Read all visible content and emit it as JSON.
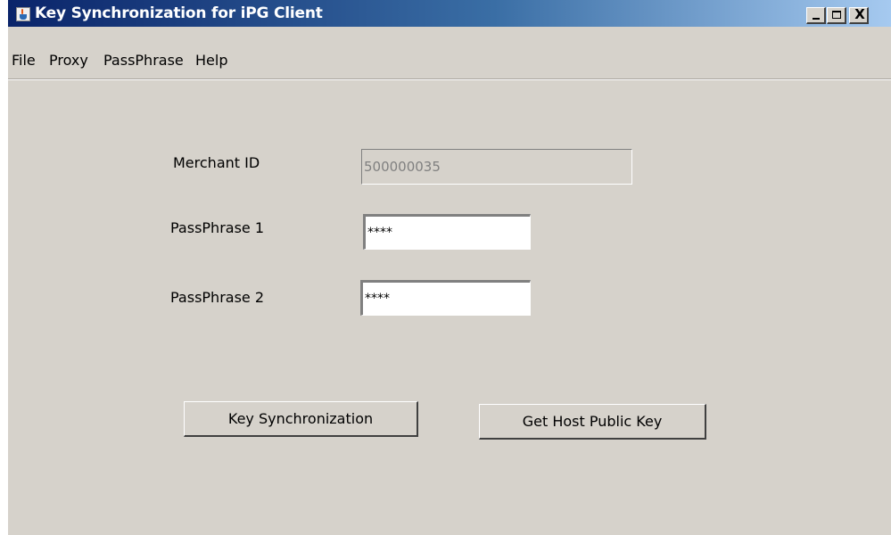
{
  "window": {
    "title": "Key Synchronization for iPG Client",
    "icon": "java-cup-icon",
    "controls": {
      "minimize_icon": "minimize-icon",
      "maximize_icon": "maximize-icon",
      "close_label": "X"
    },
    "colors": {
      "titlebar_start": "#0a246a",
      "titlebar_end": "#a6caf0",
      "panel_bg": "#d6d2cb"
    }
  },
  "menu": {
    "items": [
      {
        "label": "File"
      },
      {
        "label": "Proxy"
      },
      {
        "label": "PassPhrase"
      },
      {
        "label": "Help"
      }
    ]
  },
  "form": {
    "merchant_id": {
      "label": "Merchant ID",
      "value": "500000035",
      "enabled": false
    },
    "passphrase1": {
      "label": "PassPhrase 1",
      "value": "****"
    },
    "passphrase2": {
      "label": "PassPhrase 2",
      "value": "****"
    }
  },
  "actions": {
    "key_sync_label": "Key Synchronization",
    "get_host_key_label": "Get Host Public Key"
  }
}
